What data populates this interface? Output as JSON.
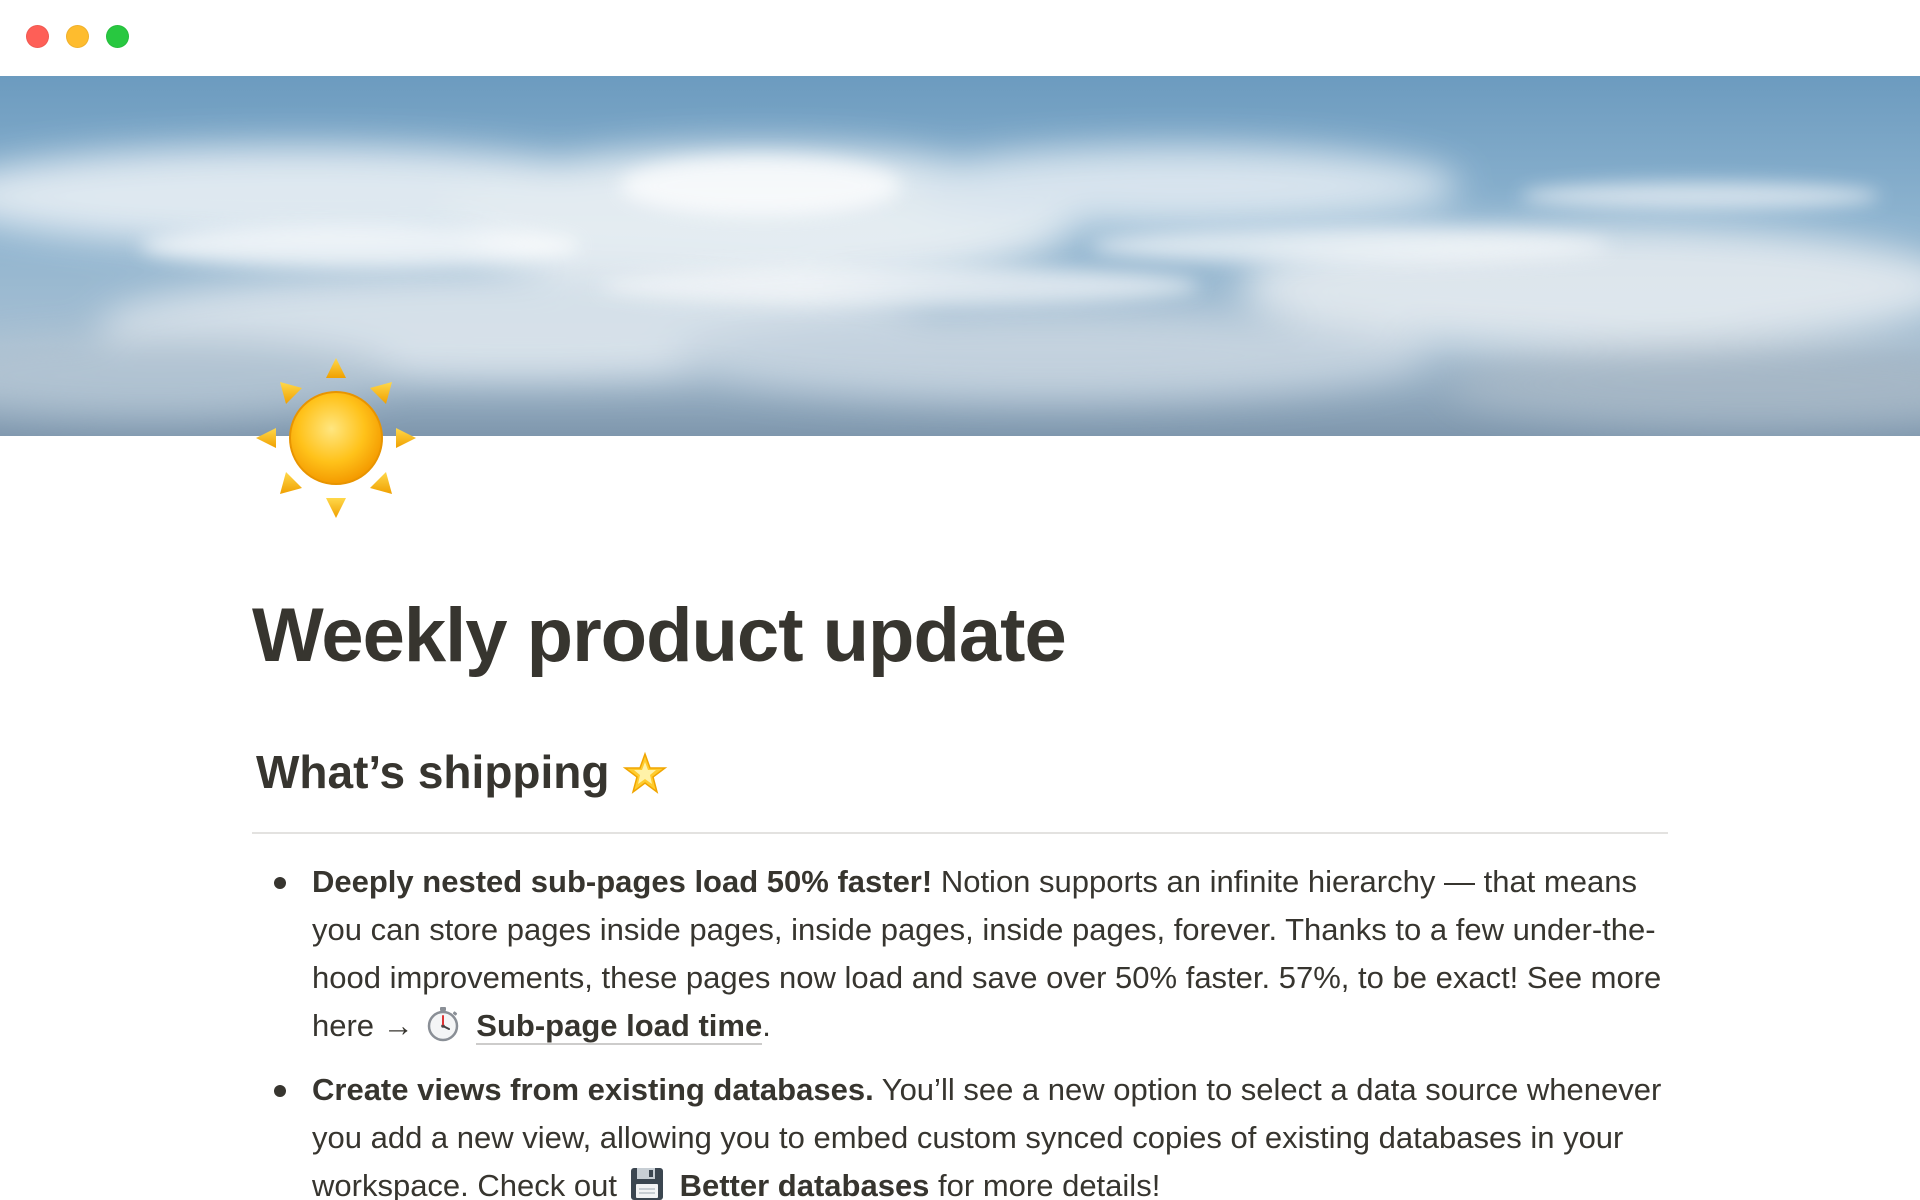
{
  "window": {
    "controls": [
      "close",
      "minimize",
      "zoom"
    ]
  },
  "page": {
    "title": "Weekly product update",
    "icon": "sun-icon"
  },
  "section": {
    "heading": "What’s shipping",
    "heading_icon": "glowing-star-icon"
  },
  "bullets": [
    {
      "bold": "Deeply nested sub-pages load 50% faster!",
      "text": " Notion supports an infinite hierarchy — that means you can store pages inside pages, inside pages, inside pages, forever. Thanks to a few under-the-hood improvements, these pages now load and save over 50% faster. 57%, to be exact! See more here → ",
      "link_icon": "stopwatch-icon",
      "link_label": "Sub-page load time",
      "after": "."
    },
    {
      "bold": "Create views from existing databases.",
      "text": " You’ll see a new option to select a data source whenever you add a new view, allowing you to embed custom synced copies of existing databases in your workspace. Check out ",
      "link_icon": "floppy-disk-icon",
      "link_label": "Better databases",
      "after": " for more details!"
    }
  ],
  "colors": {
    "text": "#37352f",
    "divider": "#e3e2e0",
    "close": "#fe5f57",
    "minimize": "#febc2e",
    "zoom": "#28c840"
  }
}
